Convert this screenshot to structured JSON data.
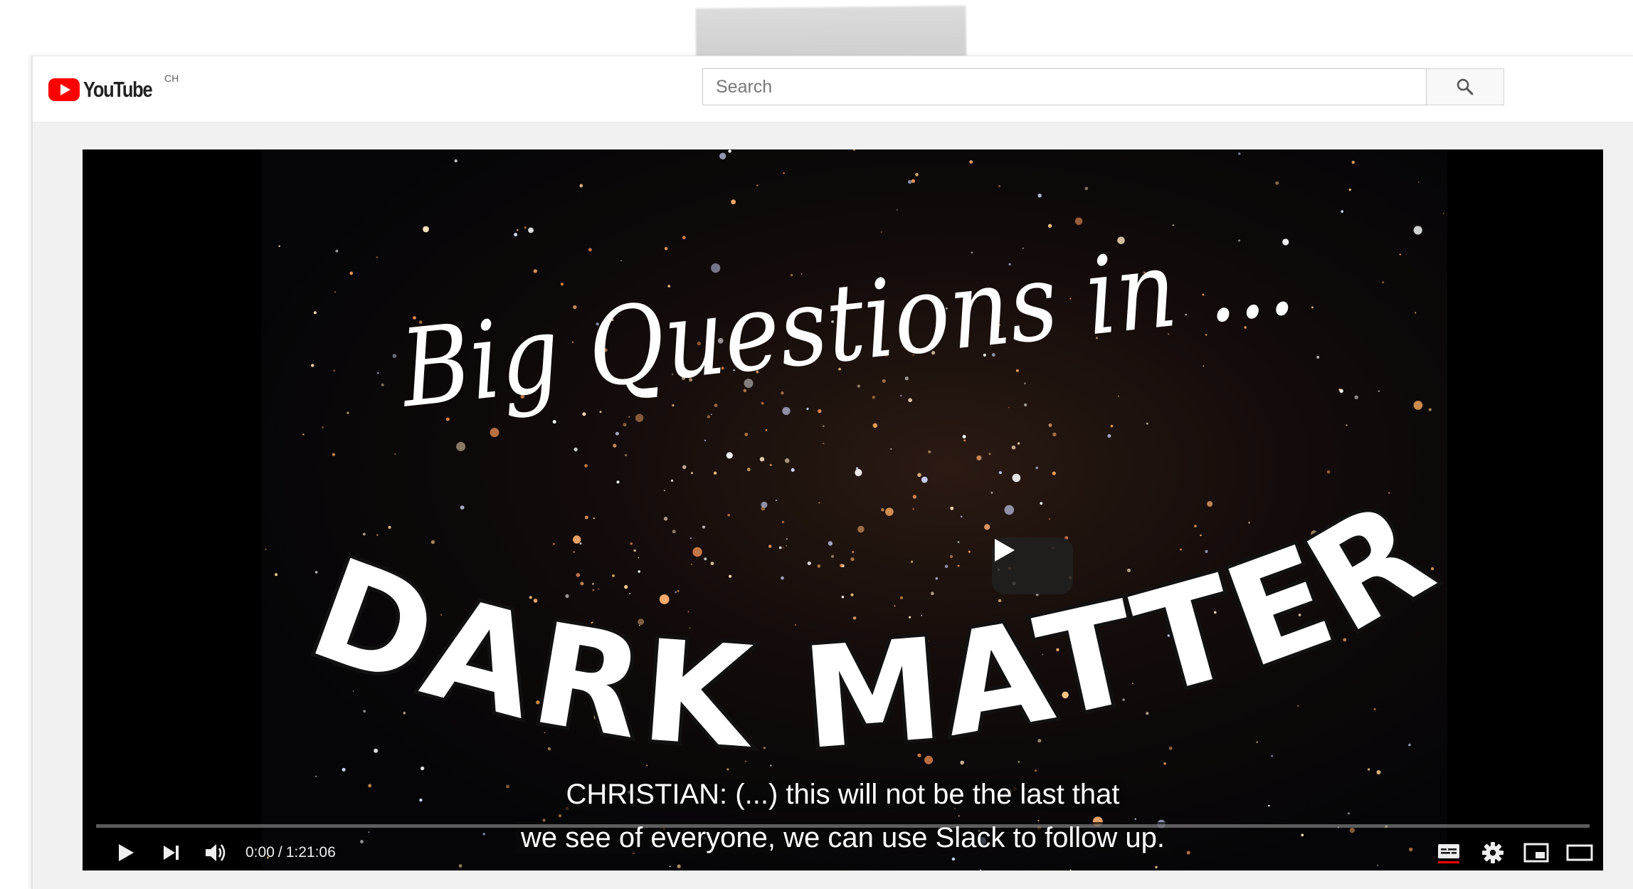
{
  "masthead": {
    "logo_word": "YouTube",
    "country_code": "CH",
    "brand_red": "#FF0000"
  },
  "search": {
    "placeholder": "Search",
    "value": "",
    "button_icon": "search-icon"
  },
  "video": {
    "title_line_1": "Big Questions in ...",
    "title_line_2": "DARK MATTER!",
    "big_play_icon": "play-icon"
  },
  "captions": {
    "line_1": "CHRISTIAN: (...) this will not be the last that",
    "line_2": "we see of everyone, we can use Slack to follow up."
  },
  "controls": {
    "current_time": "0:00",
    "separator": "/",
    "duration": "1:21:06",
    "progress_fraction": 0,
    "icons": [
      "play-icon",
      "next-icon",
      "volume-icon",
      "subtitles-icon",
      "settings-gear-icon",
      "miniplayer-icon",
      "theater-mode-icon",
      "fullscreen-icon"
    ],
    "subtitles_active_color": "#FF0000"
  }
}
